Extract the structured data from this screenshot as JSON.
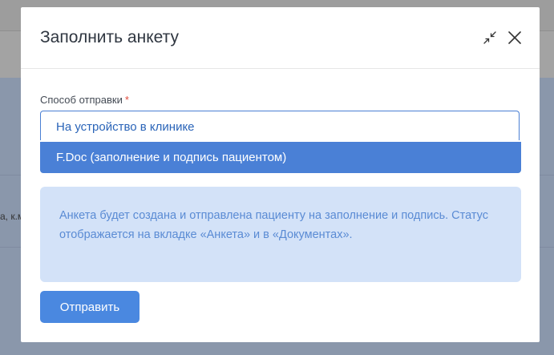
{
  "background": {
    "fragment_text": "а, к.м"
  },
  "modal": {
    "title": "Заполнить анкету",
    "collapse_icon": "collapse-arrows-icon",
    "close_icon": "close-icon"
  },
  "form": {
    "field_label": "Способ отправки",
    "required_mark": "*",
    "select_value": "На устройство в клинике",
    "dropdown_options": [
      "F.Doc (заполнение и подпись пациентом)"
    ],
    "info_text": "Анкета будет создана и отправлена пациенту на заполнение и подпись. Статус отображается на вкладке «Анкета» и в «Документах».",
    "submit_label": "Отправить"
  },
  "colors": {
    "accent": "#4a80d6",
    "info_bg": "#d3e2f8",
    "info_text": "#5a8bd4",
    "required": "#e04b3c"
  }
}
